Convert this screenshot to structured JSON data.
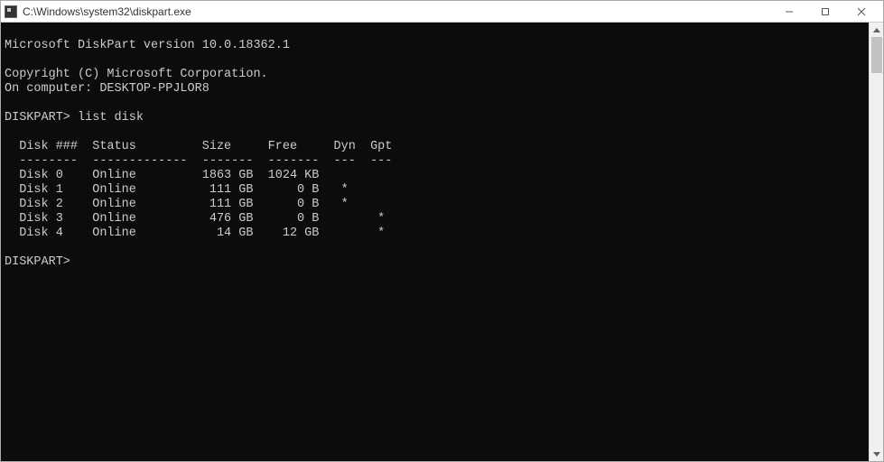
{
  "window": {
    "title": "C:\\Windows\\system32\\diskpart.exe"
  },
  "console": {
    "banner_version": "Microsoft DiskPart version 10.0.18362.1",
    "copyright": "Copyright (C) Microsoft Corporation.",
    "computer": "On computer: DESKTOP-PPJLOR8",
    "prompt1": "DISKPART> list disk",
    "prompt2": "DISKPART>",
    "table": {
      "headers": {
        "disk": "Disk ###",
        "status": "Status",
        "size": "Size",
        "free": "Free",
        "dyn": "Dyn",
        "gpt": "Gpt"
      },
      "separators": {
        "disk": "--------",
        "status": "-------------",
        "size": "-------",
        "free": "-------",
        "dyn": "---",
        "gpt": "---"
      },
      "rows": [
        {
          "disk": "Disk 0",
          "status": "Online",
          "size": "1863 GB",
          "free": "1024 KB",
          "dyn": "",
          "gpt": ""
        },
        {
          "disk": "Disk 1",
          "status": "Online",
          "size": "111 GB",
          "free": "0 B",
          "dyn": "*",
          "gpt": ""
        },
        {
          "disk": "Disk 2",
          "status": "Online",
          "size": "111 GB",
          "free": "0 B",
          "dyn": "*",
          "gpt": ""
        },
        {
          "disk": "Disk 3",
          "status": "Online",
          "size": "476 GB",
          "free": "0 B",
          "dyn": "",
          "gpt": "*"
        },
        {
          "disk": "Disk 4",
          "status": "Online",
          "size": "14 GB",
          "free": "12 GB",
          "dyn": "",
          "gpt": "*"
        }
      ]
    }
  }
}
